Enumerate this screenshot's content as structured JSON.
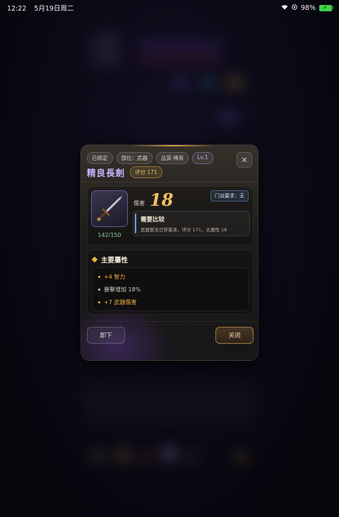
{
  "status_bar": {
    "time": "12:22",
    "date": "5月19日周二",
    "battery": "98%"
  },
  "item": {
    "tags": [
      "已綁定",
      "部位：武器",
      "品質·稀有",
      "Lv.1"
    ],
    "name": "精良長劍",
    "score": "评分 171",
    "icon": "sword-icon",
    "durability": "142/150",
    "damage_label": "傷害",
    "damage_value": "18",
    "requirement": "门派要求：无",
    "compare_title": "需要比较",
    "compare_desc": "武器暂无已穿基准，评分 171，主属性 18"
  },
  "attributes": {
    "title": "主要屬性",
    "items": [
      {
        "text": "+4 智力",
        "color": "#f0b043"
      },
      {
        "text": "暴擊增加 18%",
        "color": "#cfc8bd"
      },
      {
        "text": "+7 武器傷害",
        "color": "#f0b043"
      }
    ]
  },
  "buttons": {
    "unequip": "卸下",
    "close": "关闭"
  },
  "colors": {
    "rare_name": "#c8b5ff",
    "damage": "#f0c064",
    "accent_gold": "#e9b24a",
    "durability": "#8fd39a"
  }
}
